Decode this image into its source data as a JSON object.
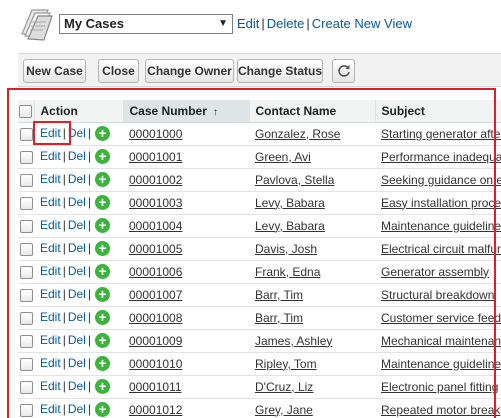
{
  "view": {
    "selected": "My Cases",
    "links": [
      "Edit",
      "Delete",
      "Create New View"
    ]
  },
  "toolbar": {
    "buttons": [
      "New Case",
      "Close",
      "Change Owner",
      "Change Status"
    ]
  },
  "table": {
    "headers": {
      "action": "Action",
      "case_number": "Case Number",
      "sort_indicator": "↑",
      "contact_name": "Contact Name",
      "subject": "Subject"
    },
    "action_labels": {
      "edit": "Edit",
      "del": "Del"
    },
    "rows": [
      {
        "case": "00001000",
        "contact": "Gonzalez, Rose",
        "subject": "Starting generator after electrical failure"
      },
      {
        "case": "00001001",
        "contact": "Green, Avi",
        "subject": "Performance inadequate for second consecutive week"
      },
      {
        "case": "00001002",
        "contact": "Pavlova, Stella",
        "subject": "Seeking guidance on electrical wiring installation"
      },
      {
        "case": "00001003",
        "contact": "Levy, Babara",
        "subject": "Easy installation process"
      },
      {
        "case": "00001004",
        "contact": "Levy, Babara",
        "subject": "Maintenance guidelines for generator unclear"
      },
      {
        "case": "00001005",
        "contact": "Davis, Josh",
        "subject": "Electrical circuit malfunctioning"
      },
      {
        "case": "00001006",
        "contact": "Frank, Edna",
        "subject": "Generator assembly"
      },
      {
        "case": "00001007",
        "contact": "Barr, Tim",
        "subject": "Structural breakdown"
      },
      {
        "case": "00001008",
        "contact": "Barr, Tim",
        "subject": "Customer service feedback"
      },
      {
        "case": "00001009",
        "contact": "James, Ashley",
        "subject": "Mechanical maintenance"
      },
      {
        "case": "00001010",
        "contact": "Ripley, Tom",
        "subject": "Maintenance guidelines"
      },
      {
        "case": "00001011",
        "contact": "D'Cruz, Liz",
        "subject": "Electronic panel fitting"
      },
      {
        "case": "00001012",
        "contact": "Grey, Jane",
        "subject": "Repeated motor break"
      }
    ]
  },
  "colors": {
    "link": "#015ba7",
    "highlight": "#e21e25",
    "plus": "#3cb33c"
  }
}
